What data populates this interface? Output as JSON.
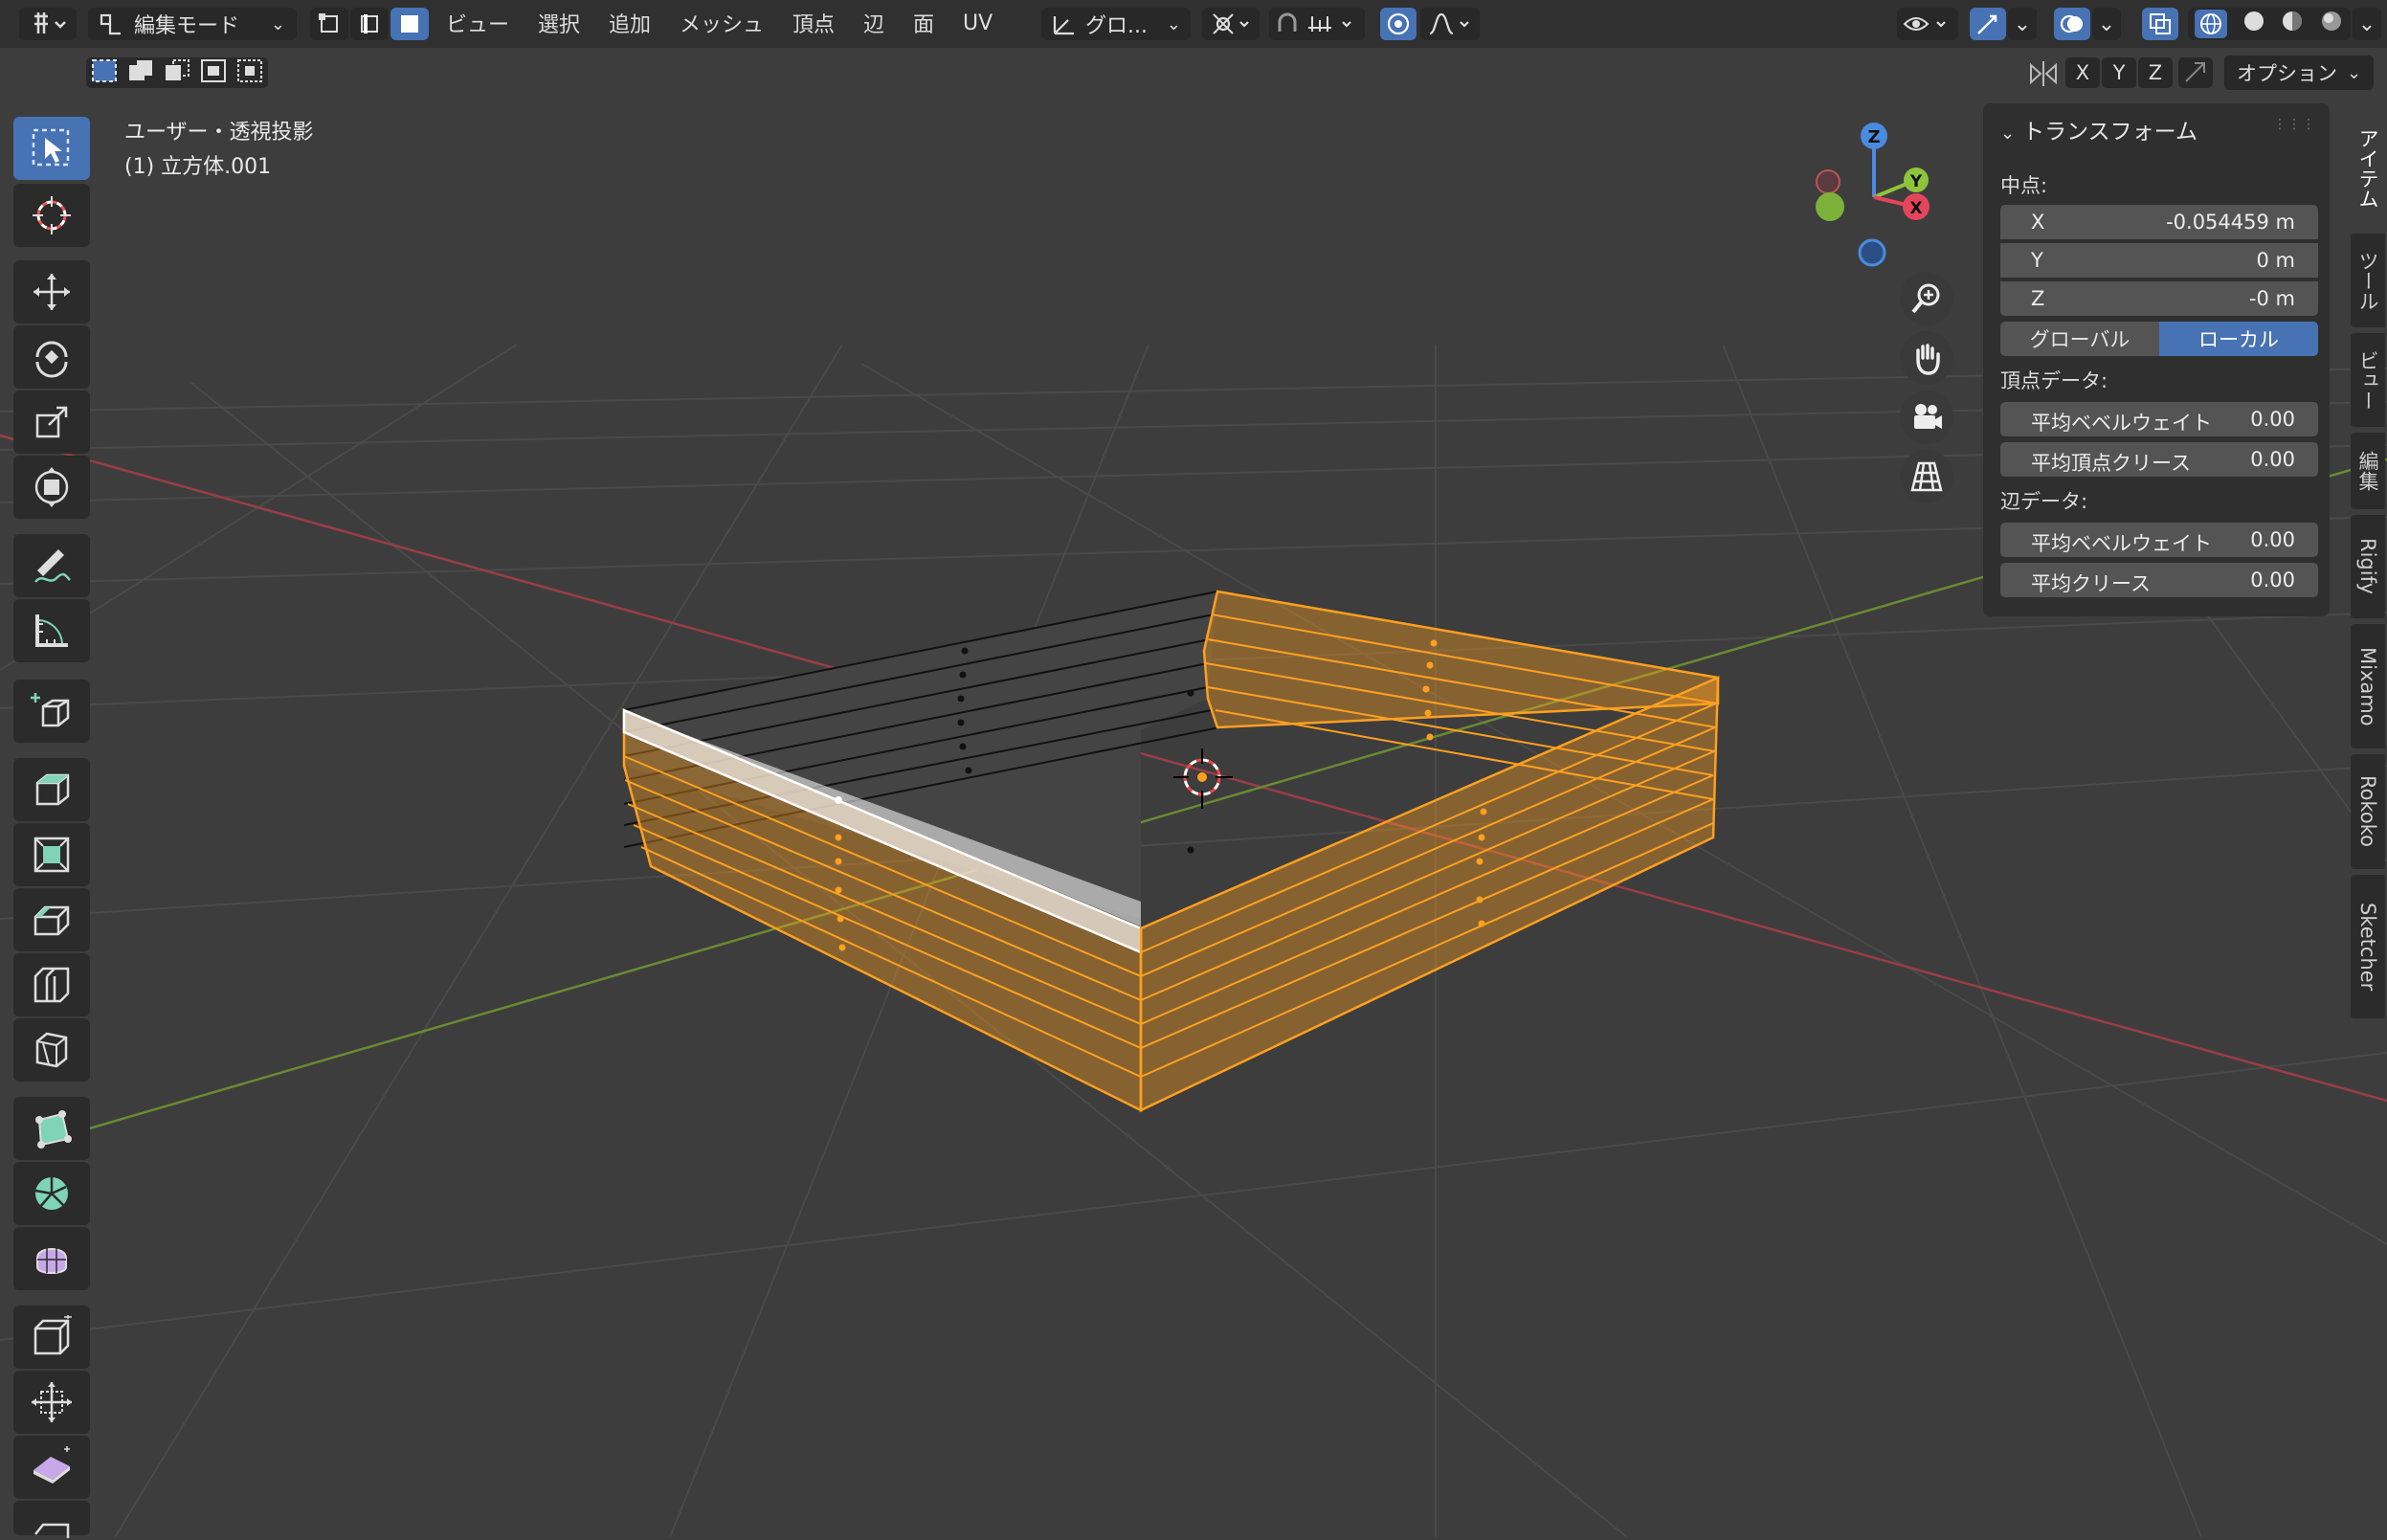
{
  "header": {
    "mode": "編集モード",
    "menus": [
      "ビュー",
      "選択",
      "追加",
      "メッシュ",
      "頂点",
      "辺",
      "面",
      "UV"
    ],
    "transform_orientation": "グロ...",
    "axis_x": "X",
    "axis_y": "Y",
    "axis_z": "Z",
    "options": "オプション"
  },
  "viewport": {
    "view_name": "ユーザー・透視投影",
    "object_name": "(1) 立方体.001",
    "gizmo_z": "Z",
    "gizmo_y": "Y",
    "gizmo_x": "X"
  },
  "panel": {
    "title": "トランスフォーム",
    "median_label": "中点:",
    "x_label": "X",
    "x_value": "-0.054459 m",
    "y_label": "Y",
    "y_value": "0 m",
    "z_label": "Z",
    "z_value": "-0 m",
    "global": "グローバル",
    "local": "ローカル",
    "vertex_data": "頂点データ:",
    "mean_bevel_weight": "平均ベベルウェイト",
    "mean_bevel_weight_v": "0.00",
    "mean_vertex_crease": "平均頂点クリース",
    "mean_vertex_crease_v": "0.00",
    "edge_data": "辺データ:",
    "edge_bevel_weight": "平均ベベルウェイト",
    "edge_bevel_weight_v": "0.00",
    "mean_crease": "平均クリース",
    "mean_crease_v": "0.00"
  },
  "tabs": [
    "アイテム",
    "ツール",
    "ビュー",
    "編集",
    "Rigify",
    "Mixamo",
    "Rokoko",
    "Sketcher"
  ],
  "colors": {
    "accent": "#4772b3",
    "selection": "#ffa020",
    "background": "#3d3d3d"
  }
}
